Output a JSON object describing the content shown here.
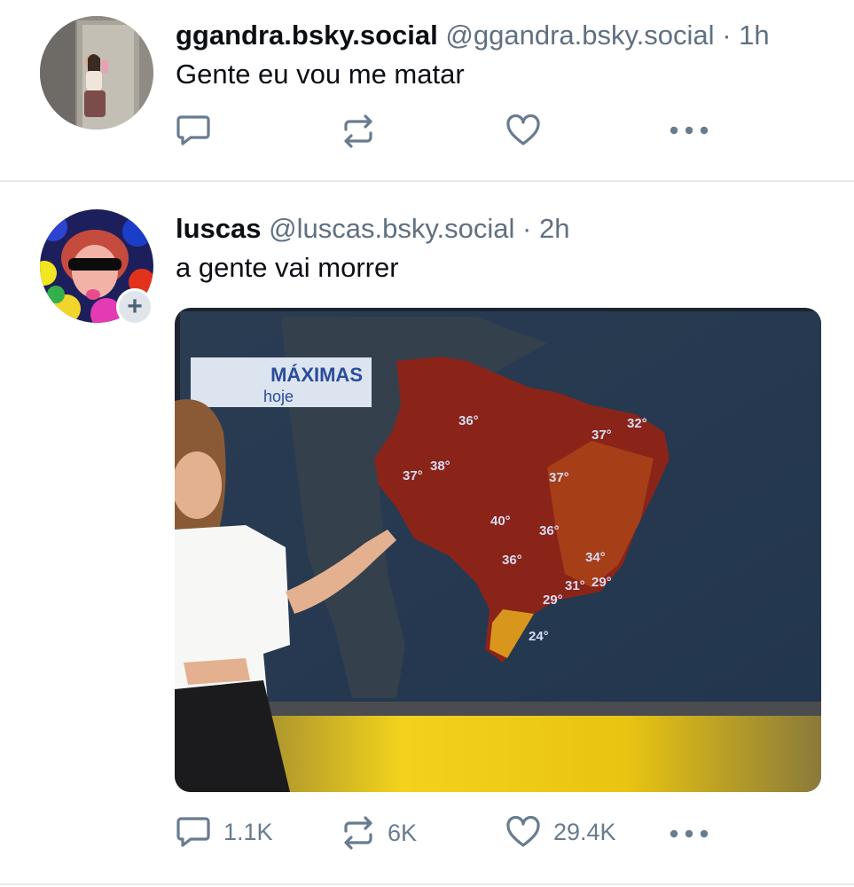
{
  "posts": [
    {
      "display_name": "ggandra.bsky.social",
      "handle": "@ggandra.bsky.social",
      "separator": "·",
      "time": "1h",
      "text": "Gente eu vou me matar",
      "reply_count": "",
      "repost_count": "",
      "like_count": ""
    },
    {
      "display_name": "luscas",
      "handle": "@luscas.bsky.social",
      "separator": "·",
      "time": "2h",
      "text": "a gente vai morrer",
      "follow_badge": "+",
      "reply_count": "1.1K",
      "repost_count": "6K",
      "like_count": "29.4K",
      "image": {
        "banner_title": "MÁXIMAS",
        "banner_subtitle": "hoje",
        "temperatures": [
          "36°",
          "37°",
          "32°",
          "37°",
          "38°",
          "37°",
          "40°",
          "36°",
          "36°",
          "34°",
          "31°",
          "29°",
          "29°",
          "24°"
        ]
      }
    }
  ],
  "colors": {
    "text_primary": "#0b0f14",
    "text_secondary": "#5f7081",
    "icon": "#687c90",
    "divider": "#e6ebef"
  }
}
